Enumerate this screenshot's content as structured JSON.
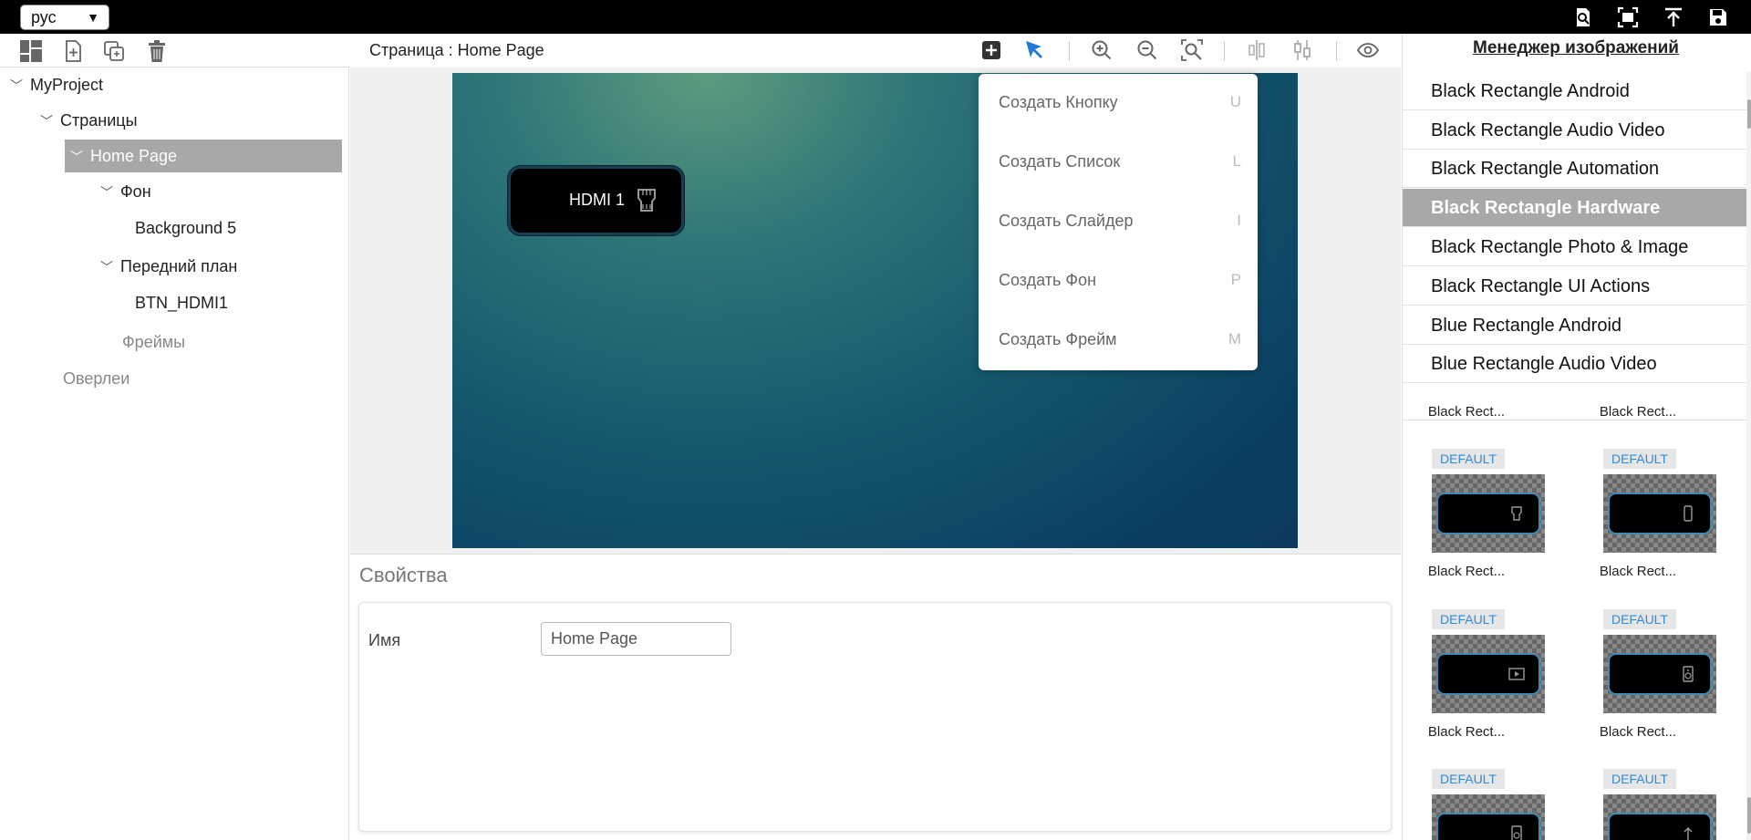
{
  "topbar": {
    "language": "рус",
    "icons": [
      "search-document-icon",
      "fit-screen-icon",
      "upload-icon",
      "save-icon"
    ]
  },
  "left_toolbar": {
    "icons": [
      "layout-icon",
      "new-page-icon",
      "duplicate-icon",
      "trash-icon"
    ]
  },
  "tree": {
    "project": "MyProject",
    "pages": "Страницы",
    "home_page": "Home Page",
    "background_group": "Фон",
    "background_item": "Background 5",
    "foreground_group": "Передний план",
    "foreground_item": "BTN_HDMI1",
    "frames": "Фреймы",
    "overlays": "Оверлеи"
  },
  "center": {
    "title": "Страница : Home Page",
    "toolbar_icons": [
      "add-icon",
      "pointer-icon",
      "zoom-in-icon",
      "zoom-out-icon",
      "zoom-fit-icon",
      "align-horizontal-icon",
      "align-vertical-icon",
      "preview-eye-icon"
    ]
  },
  "canvas": {
    "button_label": "HDMI 1",
    "button_icon": "hdmi-icon"
  },
  "dropdown": {
    "items": [
      {
        "label": "Создать Кнопку",
        "shortcut": "U"
      },
      {
        "label": "Создать Список",
        "shortcut": "L"
      },
      {
        "label": "Создать Слайдер",
        "shortcut": "I"
      },
      {
        "label": "Создать Фон",
        "shortcut": "P"
      },
      {
        "label": "Создать Фрейм",
        "shortcut": "M"
      }
    ]
  },
  "properties": {
    "title": "Свойства",
    "name_label": "Имя",
    "name_value": "Home Page"
  },
  "image_manager": {
    "title": "Менеджер изображений",
    "categories": [
      "Black Rectangle Android",
      "Black Rectangle Audio Video",
      "Black Rectangle Automation",
      "Black Rectangle Hardware",
      "Black Rectangle Photo & Image",
      "Black Rectangle UI Actions",
      "Blue Rectangle Android",
      "Blue Rectangle Audio Video"
    ],
    "selected_category": "Black Rectangle Hardware",
    "tiles": [
      {
        "caption": "Black Rect...",
        "badge": "",
        "icon": ""
      },
      {
        "caption": "Black Rect...",
        "badge": "",
        "icon": ""
      },
      {
        "caption": "Black Rect...",
        "badge": "DEFAULT",
        "icon": "hdmi-icon"
      },
      {
        "caption": "Black Rect...",
        "badge": "DEFAULT",
        "icon": "phone-icon"
      },
      {
        "caption": "Black Rect...",
        "badge": "DEFAULT",
        "icon": "play-box-icon"
      },
      {
        "caption": "Black Rect...",
        "badge": "DEFAULT",
        "icon": "speaker-icon"
      },
      {
        "caption": "",
        "badge": "DEFAULT",
        "icon": "speaker-small-icon"
      },
      {
        "caption": "",
        "badge": "DEFAULT",
        "icon": "arrow-up-icon"
      }
    ]
  },
  "colors": {
    "selected_row": "#a8a8a8",
    "active_pointer": "#1f7ad6",
    "badge_text": "#2f8ad8"
  }
}
